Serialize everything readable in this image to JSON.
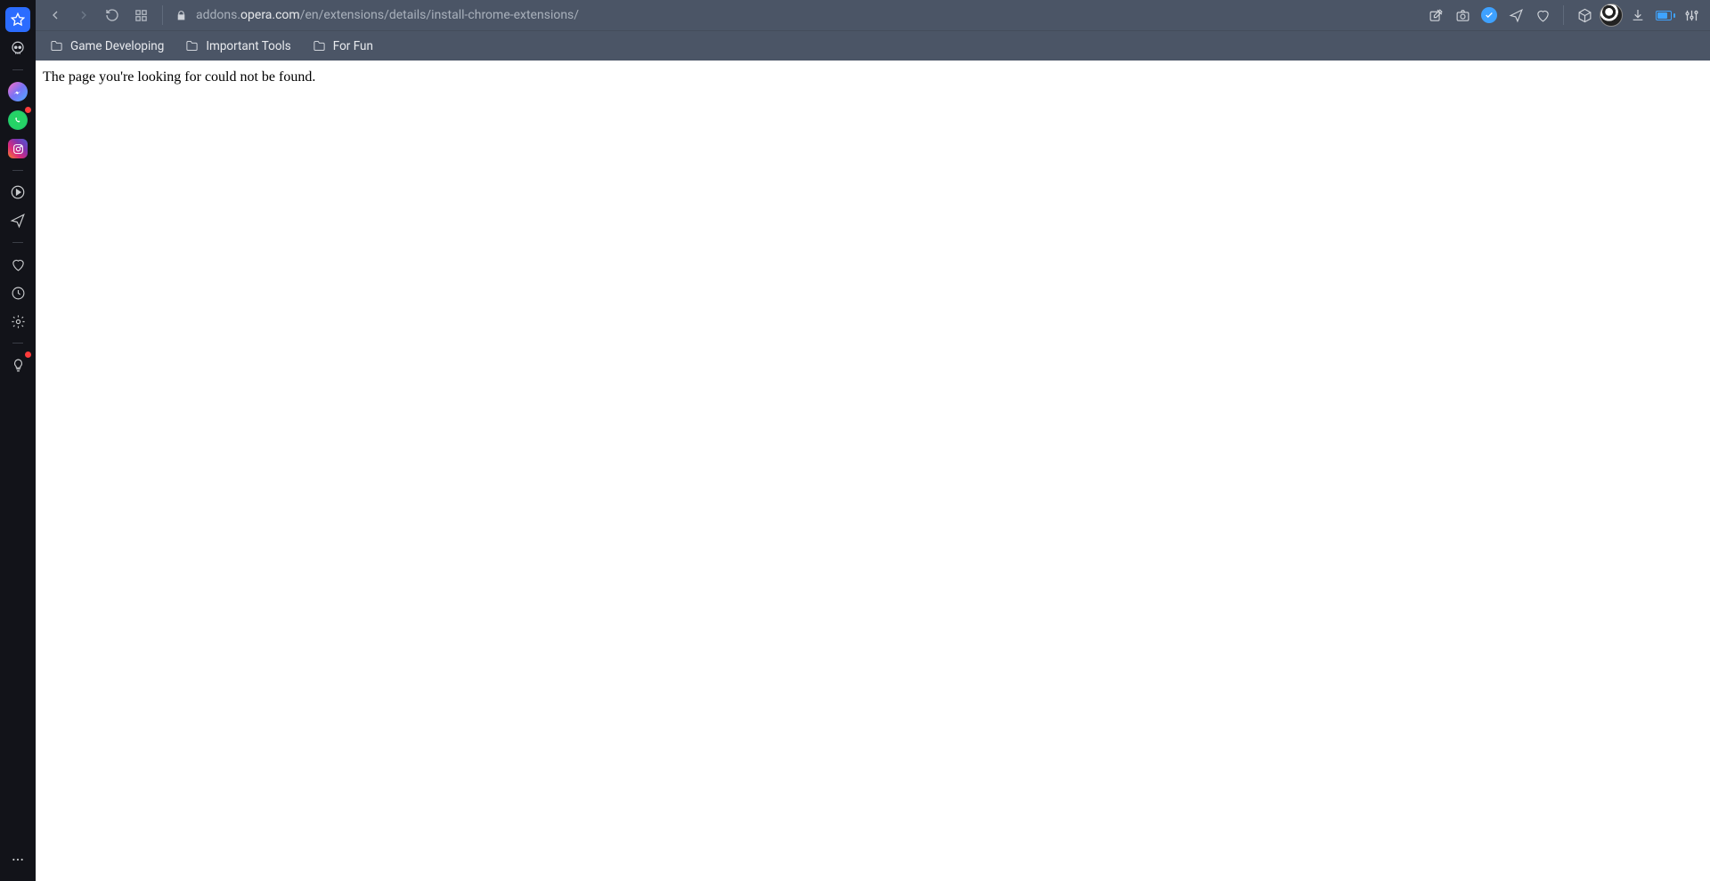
{
  "url": {
    "prefix": "addons.",
    "domain": "opera.com",
    "path": "/en/extensions/details/install-chrome-extensions/"
  },
  "bookmarks": [
    {
      "label": "Game Developing"
    },
    {
      "label": "Important Tools"
    },
    {
      "label": "For Fun"
    }
  ],
  "page": {
    "message": "The page you're looking for could not be found."
  },
  "sidebar": {
    "items": [
      {
        "name": "speed-dial",
        "active": true
      },
      {
        "name": "skull-app"
      },
      {
        "name": "divider"
      },
      {
        "name": "messenger",
        "dot": false
      },
      {
        "name": "whatsapp",
        "dot": true
      },
      {
        "name": "instagram"
      },
      {
        "name": "divider"
      },
      {
        "name": "player"
      },
      {
        "name": "send-plane"
      },
      {
        "name": "divider"
      },
      {
        "name": "heart-pinboards"
      },
      {
        "name": "history"
      },
      {
        "name": "settings"
      },
      {
        "name": "divider"
      },
      {
        "name": "hint-bulb",
        "dot": true
      }
    ]
  },
  "toolbar_right": [
    "screenshot-edit",
    "camera",
    "verified",
    "send",
    "heart",
    "sep",
    "extensions-cube",
    "avatar",
    "download",
    "battery",
    "easy-setup"
  ]
}
